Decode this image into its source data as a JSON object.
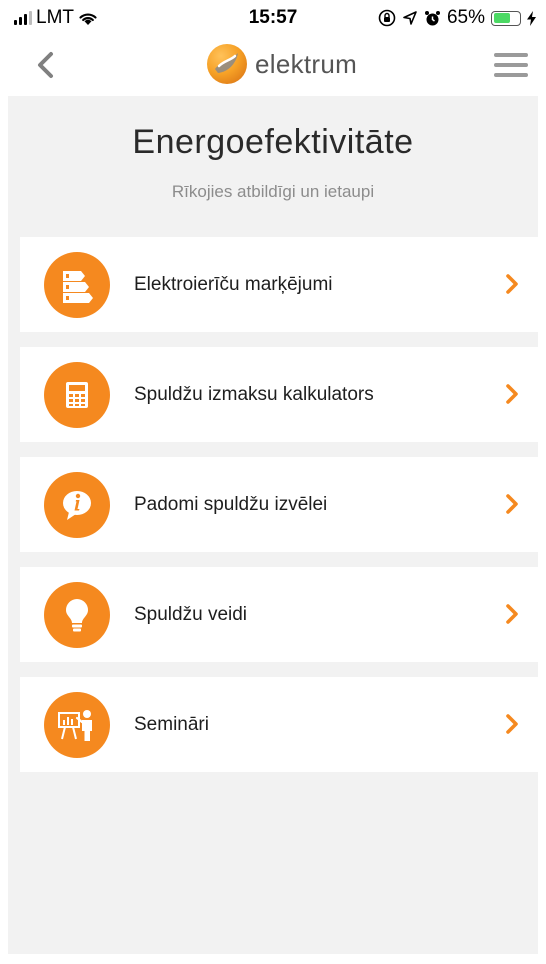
{
  "status_bar": {
    "carrier": "LMT",
    "time": "15:57",
    "battery": "65%",
    "battery_level": 0.65,
    "battery_color": "#4cd964"
  },
  "navbar": {
    "back_icon": "chevron-left-icon",
    "logo_text": "elektrum",
    "menu_icon": "hamburger-menu-icon"
  },
  "page": {
    "title": "Energoefektivitāte",
    "subtitle": "Rīkojies atbildīgi un ietaupi"
  },
  "items": [
    {
      "label": "Elektroierīču marķējumi",
      "icon": "energy-label-icon"
    },
    {
      "label": "Spuldžu izmaksu kalkulators",
      "icon": "calculator-icon"
    },
    {
      "label": "Padomi spuldžu izvēlei",
      "icon": "info-bubble-icon"
    },
    {
      "label": "Spuldžu veidi",
      "icon": "lightbulb-icon"
    },
    {
      "label": "Semināri",
      "icon": "presentation-icon"
    }
  ],
  "colors": {
    "accent": "#f5891f",
    "background": "#f2f2f2",
    "card": "#ffffff"
  }
}
